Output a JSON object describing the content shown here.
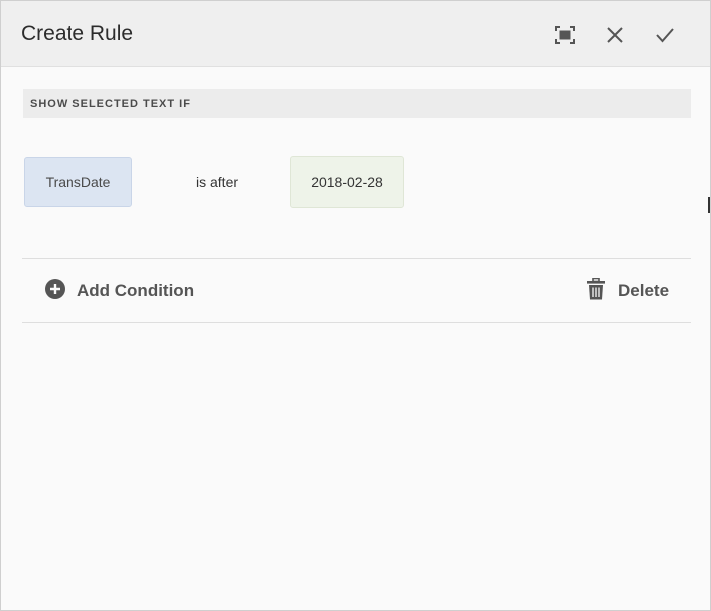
{
  "dialog": {
    "title": "Create Rule",
    "header_buttons": [
      {
        "name": "fullscreen-button",
        "icon": "fullscreen-icon"
      },
      {
        "name": "close-button",
        "icon": "close-icon"
      },
      {
        "name": "confirm-button",
        "icon": "checkmark-icon"
      }
    ]
  },
  "rule": {
    "section_label": "SHOW SELECTED TEXT IF",
    "condition": {
      "field": "TransDate",
      "operator": "is after",
      "value": "2018-02-28"
    },
    "add_condition_label": "Add Condition",
    "delete_label": "Delete",
    "add_icon": "plus-circle-icon",
    "delete_icon": "trash-icon"
  },
  "colors": {
    "header_bg": "#efefef",
    "field_token_bg": "#dce5f2",
    "value_token_bg": "#eef3e9",
    "icon_color": "#555555"
  }
}
